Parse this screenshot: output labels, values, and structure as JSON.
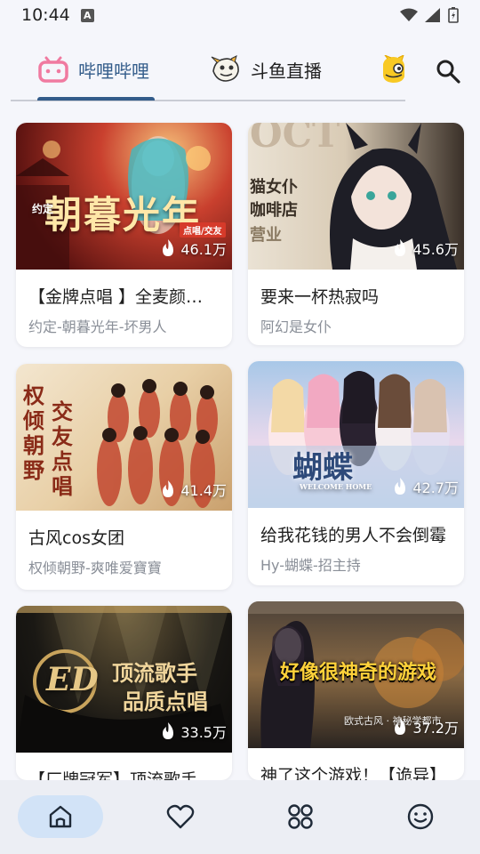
{
  "status": {
    "time": "10:44",
    "notification": "A"
  },
  "tabs": [
    {
      "label": "哔哩哔哩",
      "active": true,
      "icon": "bilibili-icon"
    },
    {
      "label": "斗鱼直播",
      "active": false,
      "icon": "douyu-icon"
    },
    {
      "label": "",
      "active": false,
      "icon": "huya-icon"
    }
  ],
  "colors": {
    "accent": "#335c8a",
    "nav_active_bg": "#d2e3f7"
  },
  "cards": [
    {
      "title": "【金牌点唱 】全麦颜值天花板",
      "subtitle": "约定-朝暮光年-坏男人",
      "views": "46.1万",
      "thumb_text": "朝暮光年",
      "thumb_small": "约定",
      "thumb_tag": "点唱/交友"
    },
    {
      "title": "要来一杯热寂吗",
      "subtitle": "阿幻是女仆",
      "views": "45.6万",
      "thumb_text": "猫女仆 咖啡店",
      "thumb_small": "OCT",
      "thumb_tag": "营业"
    },
    {
      "title": "古风cos女团",
      "subtitle": "权倾朝野-爽唯爱寶寶",
      "views": "41.4万",
      "thumb_text": "权倾朝野",
      "thumb_small": "交友点唱",
      "thumb_tag": ""
    },
    {
      "title": "给我花钱的男人不会倒霉",
      "subtitle": "Hy-蝴蝶-招主持",
      "views": "42.7万",
      "thumb_text": "蝴蝶",
      "thumb_small": "WELCOME HOME",
      "thumb_tag": ""
    },
    {
      "title": "【厂牌冠军】顶流歌手品质点唱",
      "subtitle": "",
      "views": "33.5万",
      "thumb_text": "顶流歌手",
      "thumb_small": "品质点唱",
      "thumb_tag": "ED"
    },
    {
      "title": "神了这个游戏！【诡异】",
      "subtitle": "",
      "views": "37.2万",
      "thumb_text": "好像很神奇的游戏",
      "thumb_small": "欧式古风 · 神秘学都市",
      "thumb_tag": ""
    }
  ],
  "bottom_nav": [
    {
      "name": "home",
      "active": true
    },
    {
      "name": "favorites",
      "active": false
    },
    {
      "name": "categories",
      "active": false
    },
    {
      "name": "profile",
      "active": false
    }
  ]
}
